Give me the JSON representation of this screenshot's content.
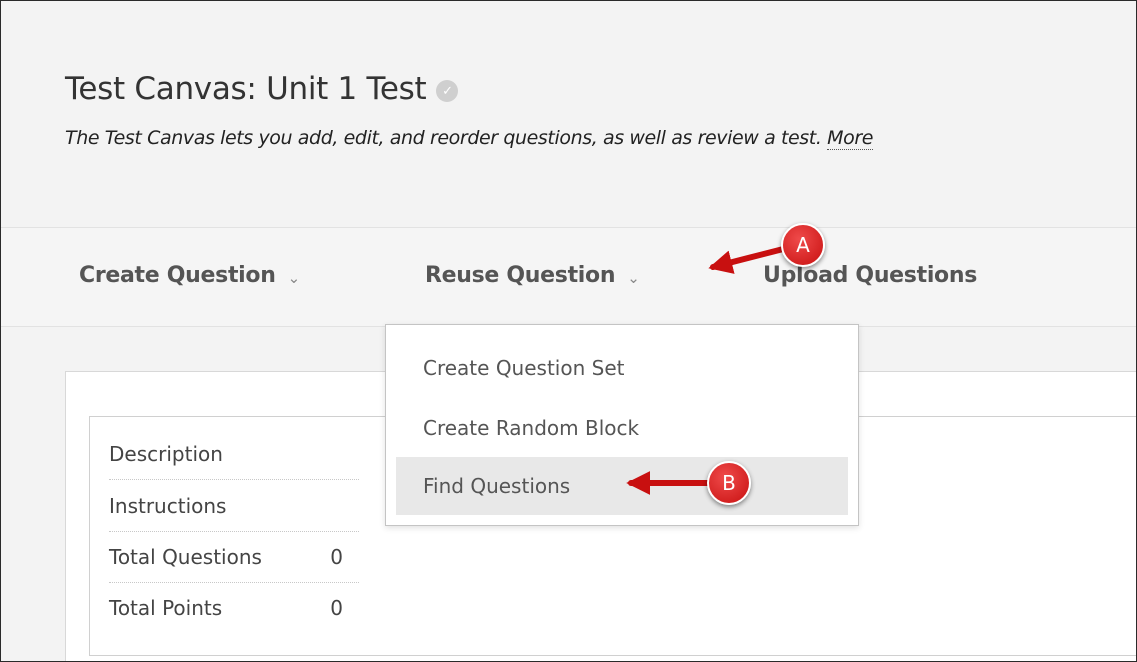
{
  "header": {
    "title": "Test Canvas: Unit 1 Test",
    "subtitle": "The Test Canvas lets you add, edit, and reorder questions, as well as review a test.",
    "more_link": "More"
  },
  "toolbar": {
    "create_question": "Create Question",
    "reuse_question": "Reuse Question",
    "upload_questions": "Upload Questions"
  },
  "dropdown": {
    "items": [
      {
        "label": "Create Question Set"
      },
      {
        "label": "Create Random Block"
      },
      {
        "label": "Find Questions",
        "highlighted": true
      }
    ]
  },
  "info": {
    "rows": [
      {
        "label": "Description",
        "value": ""
      },
      {
        "label": "Instructions",
        "value": ""
      },
      {
        "label": "Total Questions",
        "value": "0"
      },
      {
        "label": "Total Points",
        "value": "0"
      }
    ]
  },
  "callouts": {
    "a": "A",
    "b": "B"
  },
  "colors": {
    "callout_red": "#d11a1a",
    "highlight": "#e8e8e8"
  }
}
